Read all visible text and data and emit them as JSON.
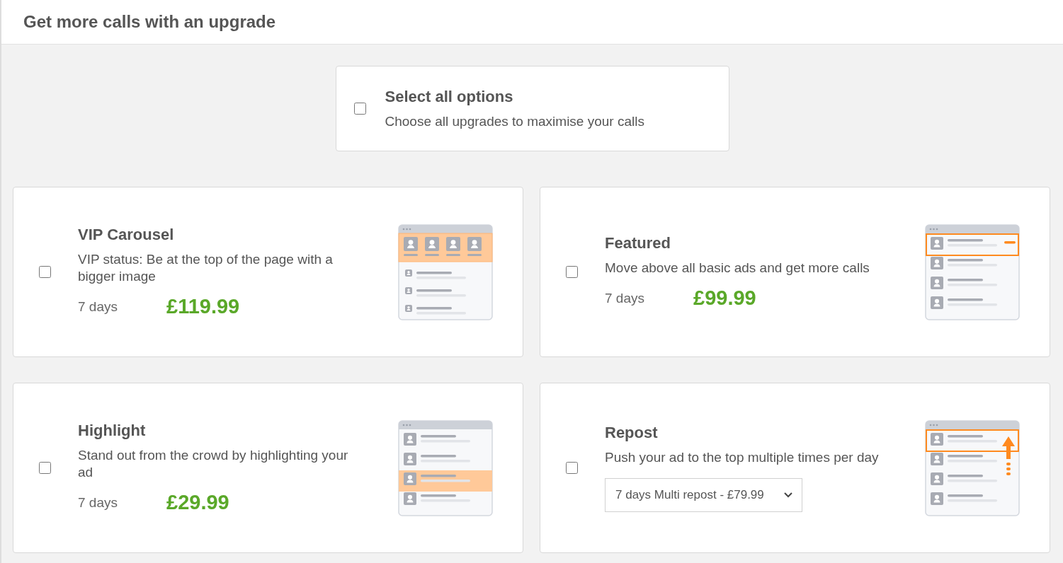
{
  "header": {
    "title": "Get more calls with an upgrade"
  },
  "select_all": {
    "title": "Select all options",
    "description": "Choose all upgrades to maximise your calls",
    "checked": false
  },
  "options": [
    {
      "kind": "carousel",
      "title": "VIP Carousel",
      "description": "VIP status: Be at the top of the page with a bigger image",
      "duration": "7 days",
      "price": "£119.99",
      "checked": false
    },
    {
      "kind": "featured",
      "title": "Featured",
      "description": "Move above all basic ads and get more calls",
      "duration": "7 days",
      "price": "£99.99",
      "checked": false
    },
    {
      "kind": "highlight",
      "title": "Highlight",
      "description": "Stand out from the crowd by highlighting your ad",
      "duration": "7 days",
      "price": "£29.99",
      "checked": false
    },
    {
      "kind": "repost",
      "title": "Repost",
      "description": "Push your ad to the top multiple times per day",
      "dropdown_value": "7 days Multi repost - £79.99",
      "checked": false
    }
  ]
}
